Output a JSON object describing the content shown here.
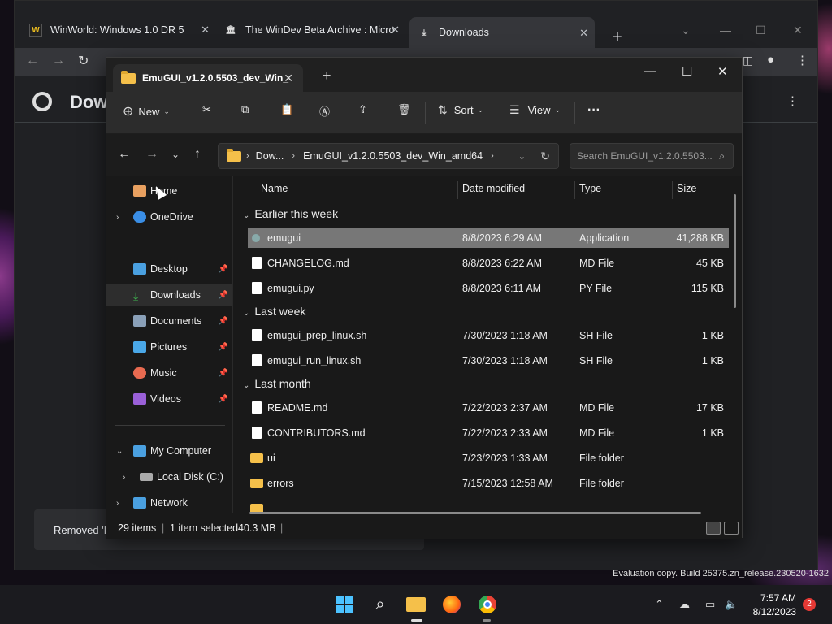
{
  "chrome": {
    "tabs": [
      {
        "title": "WinWorld: Windows 1.0 DR 5",
        "icon": "W"
      },
      {
        "title": "The WinDev Beta Archive : Micro",
        "icon": "archive"
      },
      {
        "title": "Downloads",
        "icon": "download"
      }
    ],
    "page_title": "Dow",
    "toast_text": "Removed 'E"
  },
  "explorer": {
    "tab_title": "EmuGUI_v1.2.0.5503_dev_Win_",
    "commands": {
      "new": "New",
      "sort": "Sort",
      "view": "View"
    },
    "breadcrumb": [
      "Dow...",
      "EmuGUI_v1.2.0.5503_dev_Win_amd64"
    ],
    "search_placeholder": "Search EmuGUI_v1.2.0.5503...",
    "nav": [
      {
        "label": "Home"
      },
      {
        "label": "OneDrive"
      },
      {
        "label": "Desktop"
      },
      {
        "label": "Downloads"
      },
      {
        "label": "Documents"
      },
      {
        "label": "Pictures"
      },
      {
        "label": "Music"
      },
      {
        "label": "Videos"
      },
      {
        "label": "My Computer"
      },
      {
        "label": "Local Disk (C:)"
      },
      {
        "label": "Network"
      }
    ],
    "columns": [
      "Name",
      "Date modified",
      "Type",
      "Size"
    ],
    "groups": [
      "Earlier this week",
      "Last week",
      "Last month"
    ],
    "files": [
      {
        "name": "emugui",
        "date": "8/8/2023 6:29 AM",
        "type": "Application",
        "size": "41,288 KB"
      },
      {
        "name": "CHANGELOG.md",
        "date": "8/8/2023 6:22 AM",
        "type": "MD File",
        "size": "45 KB"
      },
      {
        "name": "emugui.py",
        "date": "8/8/2023 6:11 AM",
        "type": "PY File",
        "size": "115 KB"
      },
      {
        "name": "emugui_prep_linux.sh",
        "date": "7/30/2023 1:18 AM",
        "type": "SH File",
        "size": "1 KB"
      },
      {
        "name": "emugui_run_linux.sh",
        "date": "7/30/2023 1:18 AM",
        "type": "SH File",
        "size": "1 KB"
      },
      {
        "name": "README.md",
        "date": "7/22/2023 2:37 AM",
        "type": "MD File",
        "size": "17 KB"
      },
      {
        "name": "CONTRIBUTORS.md",
        "date": "7/22/2023 2:33 AM",
        "type": "MD File",
        "size": "1 KB"
      },
      {
        "name": "ui",
        "date": "7/23/2023 1:33 AM",
        "type": "File folder",
        "size": ""
      },
      {
        "name": "errors",
        "date": "7/15/2023 12:58 AM",
        "type": "File folder",
        "size": ""
      }
    ],
    "status": {
      "items": "29 items",
      "selected": "1 item selected",
      "size": "40.3 MB"
    }
  },
  "eval_text": "Evaluation copy. Build 25375.zn_release.230520-1632",
  "clock": {
    "time": "7:57 AM",
    "date": "8/12/2023"
  },
  "notification_count": "2",
  "colors": {
    "accent": "#5ea8f0",
    "folder": "#f5c04a",
    "selected_row": "#777777"
  }
}
